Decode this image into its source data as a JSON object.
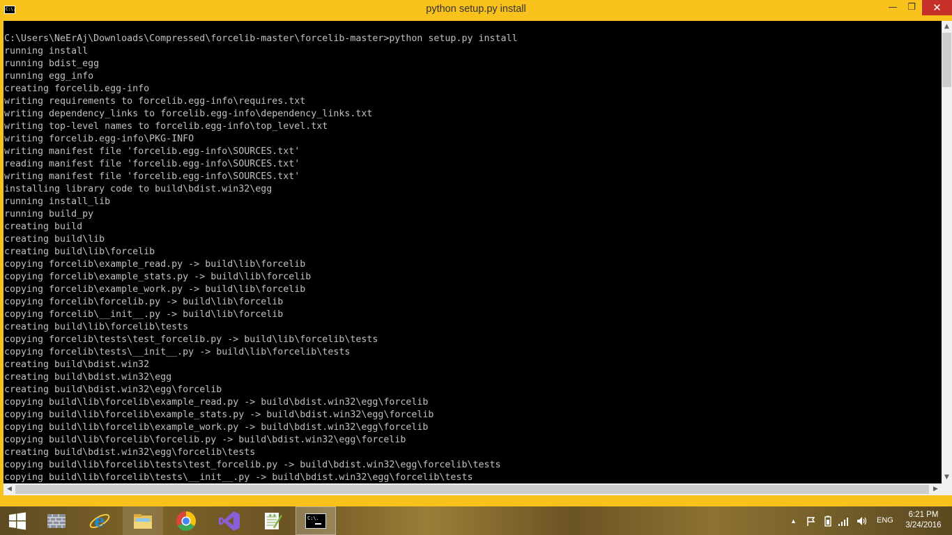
{
  "window": {
    "title": "python  setup.py install",
    "icon_text": "C:\\.",
    "controls": {
      "minimize": "—",
      "maximize": "❐",
      "close": "✕"
    }
  },
  "console": {
    "lines": [
      "C:\\Users\\NeErAj\\Downloads\\Compressed\\forcelib-master\\forcelib-master>python setup.py install",
      "running install",
      "running bdist_egg",
      "running egg_info",
      "creating forcelib.egg-info",
      "writing requirements to forcelib.egg-info\\requires.txt",
      "writing dependency_links to forcelib.egg-info\\dependency_links.txt",
      "writing top-level names to forcelib.egg-info\\top_level.txt",
      "writing forcelib.egg-info\\PKG-INFO",
      "writing manifest file 'forcelib.egg-info\\SOURCES.txt'",
      "reading manifest file 'forcelib.egg-info\\SOURCES.txt'",
      "writing manifest file 'forcelib.egg-info\\SOURCES.txt'",
      "installing library code to build\\bdist.win32\\egg",
      "running install_lib",
      "running build_py",
      "creating build",
      "creating build\\lib",
      "creating build\\lib\\forcelib",
      "copying forcelib\\example_read.py -> build\\lib\\forcelib",
      "copying forcelib\\example_stats.py -> build\\lib\\forcelib",
      "copying forcelib\\example_work.py -> build\\lib\\forcelib",
      "copying forcelib\\forcelib.py -> build\\lib\\forcelib",
      "copying forcelib\\__init__.py -> build\\lib\\forcelib",
      "creating build\\lib\\forcelib\\tests",
      "copying forcelib\\tests\\test_forcelib.py -> build\\lib\\forcelib\\tests",
      "copying forcelib\\tests\\__init__.py -> build\\lib\\forcelib\\tests",
      "creating build\\bdist.win32",
      "creating build\\bdist.win32\\egg",
      "creating build\\bdist.win32\\egg\\forcelib",
      "copying build\\lib\\forcelib\\example_read.py -> build\\bdist.win32\\egg\\forcelib",
      "copying build\\lib\\forcelib\\example_stats.py -> build\\bdist.win32\\egg\\forcelib",
      "copying build\\lib\\forcelib\\example_work.py -> build\\bdist.win32\\egg\\forcelib",
      "copying build\\lib\\forcelib\\forcelib.py -> build\\bdist.win32\\egg\\forcelib",
      "creating build\\bdist.win32\\egg\\forcelib\\tests",
      "copying build\\lib\\forcelib\\tests\\test_forcelib.py -> build\\bdist.win32\\egg\\forcelib\\tests",
      "copying build\\lib\\forcelib\\tests\\__init__.py -> build\\bdist.win32\\egg\\forcelib\\tests"
    ],
    "text_color": "#c0c0c0",
    "background": "#000000"
  },
  "theme": {
    "accent": "#f8c11c",
    "close": "#c7302a"
  },
  "taskbar": {
    "apps": [
      {
        "name": "start-button",
        "icon": "windows-logo-icon"
      },
      {
        "name": "taskbar-app-1",
        "icon": "brick-wall-icon"
      },
      {
        "name": "taskbar-ie",
        "icon": "internet-explorer-icon"
      },
      {
        "name": "taskbar-explorer",
        "icon": "file-explorer-icon"
      },
      {
        "name": "taskbar-chrome",
        "icon": "chrome-icon"
      },
      {
        "name": "taskbar-visual-studio",
        "icon": "visual-studio-icon"
      },
      {
        "name": "taskbar-notepadpp",
        "icon": "notepad-plus-plus-icon"
      },
      {
        "name": "taskbar-cmd",
        "icon": "command-prompt-icon"
      }
    ],
    "cmd_icon_text": "C:\\.",
    "tray": {
      "language": "ENG",
      "time": "6:21 PM",
      "date": "3/24/2016"
    }
  }
}
